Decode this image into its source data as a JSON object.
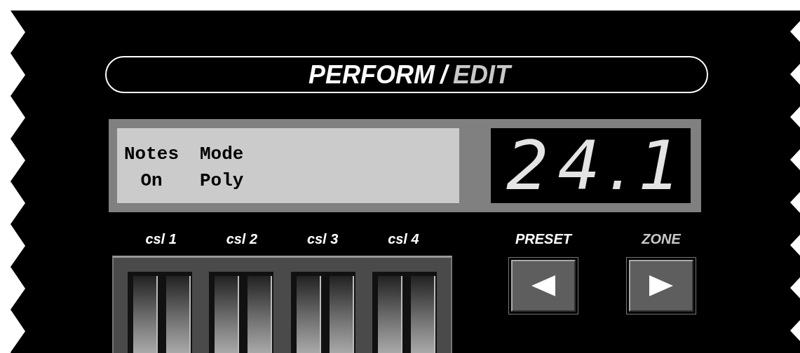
{
  "title": {
    "modes": [
      {
        "label": "PERFORM",
        "selected": true
      },
      {
        "label": "EDIT",
        "selected": false
      }
    ],
    "separator": "/"
  },
  "lcd": {
    "columns": [
      {
        "label": "Notes",
        "value": "On"
      },
      {
        "label": "Mode",
        "value": "Poly"
      }
    ]
  },
  "led_display": {
    "value": "24.1"
  },
  "sliders": [
    {
      "label": "csl 1"
    },
    {
      "label": "csl 2"
    },
    {
      "label": "csl 3"
    },
    {
      "label": "csl 4"
    }
  ],
  "nav": [
    {
      "label": "PRESET",
      "selected": true,
      "kind": "previous"
    },
    {
      "label": "ZONE",
      "selected": false,
      "kind": "next"
    }
  ]
}
